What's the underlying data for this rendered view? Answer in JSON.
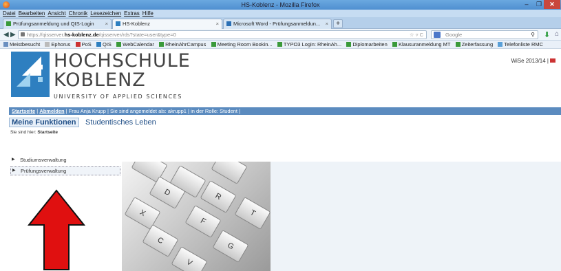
{
  "window": {
    "title": "HS-Koblenz - Mozilla Firefox",
    "min": "–",
    "max": "❐",
    "close": "✕"
  },
  "menu": [
    "Datei",
    "Bearbeiten",
    "Ansicht",
    "Chronik",
    "Lesezeichen",
    "Extras",
    "Hilfe"
  ],
  "tabs": [
    {
      "label": "Prüfungsanmeldung und QIS-Login",
      "close": "×"
    },
    {
      "label": "HS-Koblenz",
      "close": "×"
    },
    {
      "label": "Microsoft Word - Prüfungsanmeldun...",
      "close": "×"
    }
  ],
  "new_tab": "+",
  "nav": {
    "back": "◀",
    "forward": "▶",
    "url_prefix": "https://qisserver.",
    "url_host": "hs-koblenz.de",
    "url_path": "/qisserver/rds?state=user&type=0",
    "url_icons": "☆ ▿ C",
    "search_placeholder": "Google",
    "search_icon": "⚲",
    "download_icon": "⬇",
    "home_icon": "⌂"
  },
  "bookmarks": [
    "Meistbesucht",
    "Ephorus",
    "PoS",
    "QIS",
    "WebCalendar",
    "RheinAhrCampus",
    "Meeting Room Bookin...",
    "TYPO3 Login: RheinAh...",
    "Diplomarbeiten",
    "Klausuranmeldung MT",
    "Zeiterfassung",
    "Telefonliste RMC"
  ],
  "header": {
    "brand_line1": "HOCHSCHULE",
    "brand_line2": "KOBLENZ",
    "brand_line3": "UNIVERSITY OF APPLIED SCIENCES",
    "semester": "WiSe 2013/14 |"
  },
  "userbar": {
    "startseite": "Startseite",
    "sep1": " | ",
    "abmelden": "Abmelden",
    "sep2": " | ",
    "user": "Frau Anja Krupp",
    "sep3": " | ",
    "login_info": "Sie sind angemeldet als: akrupp1",
    "sep4": "  |  ",
    "role": "in der Rolle: Student",
    "sep5": " |"
  },
  "functions": {
    "meine_funktionen": "Meine Funktionen",
    "studentisches_leben": "Studentisches Leben"
  },
  "breadcrumb": {
    "prefix": "Sie sind hier: ",
    "current": "Startseite"
  },
  "sidebar": {
    "items": [
      {
        "label": "Studiumsverwaltung",
        "arrow": "▶"
      },
      {
        "label": "Prüfungsverwaltung",
        "arrow": "▶"
      }
    ]
  },
  "keyboard_keys": [
    "D",
    "R",
    "X",
    "C",
    "F",
    "T",
    "V",
    "G"
  ],
  "colors": {
    "userbar": "#5b8bbf",
    "arrow_red": "#e01010",
    "logo_blue": "#2e7fc0"
  }
}
